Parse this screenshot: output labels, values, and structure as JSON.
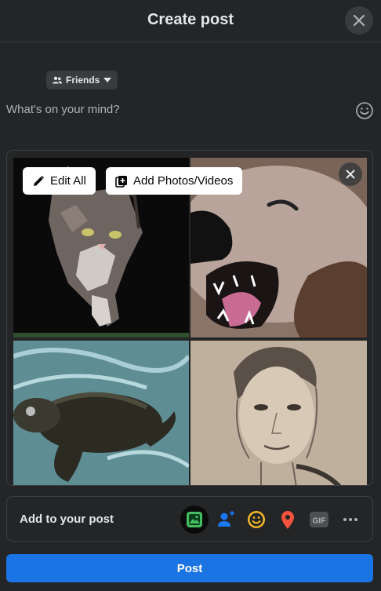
{
  "header": {
    "title": "Create post"
  },
  "audience": {
    "label": "Friends"
  },
  "composer": {
    "placeholder": "What's on your mind?"
  },
  "media": {
    "edit_all_label": "Edit All",
    "add_photos_label": "Add Photos/Videos",
    "photos": [
      {
        "icon": "cat-photo"
      },
      {
        "icon": "otter-photo"
      },
      {
        "icon": "turtle-photo"
      },
      {
        "icon": "portrait-sketch-photo"
      }
    ]
  },
  "add_to_post": {
    "label": "Add to your post",
    "icons": [
      {
        "name": "photo-video-icon",
        "color": "#45bd62"
      },
      {
        "name": "tag-people-icon",
        "color": "#1877f2"
      },
      {
        "name": "feeling-activity-icon",
        "color": "#f7b928"
      },
      {
        "name": "check-in-icon",
        "color": "#f5533d"
      },
      {
        "name": "gif-icon",
        "text": "GIF",
        "color": "#b0b3b8"
      },
      {
        "name": "more-icon",
        "color": "#b0b3b8"
      }
    ]
  },
  "post_button": {
    "label": "Post"
  },
  "colors": {
    "background": "#242526",
    "accent": "#1b74e4",
    "text_secondary": "#b0b3b8"
  }
}
